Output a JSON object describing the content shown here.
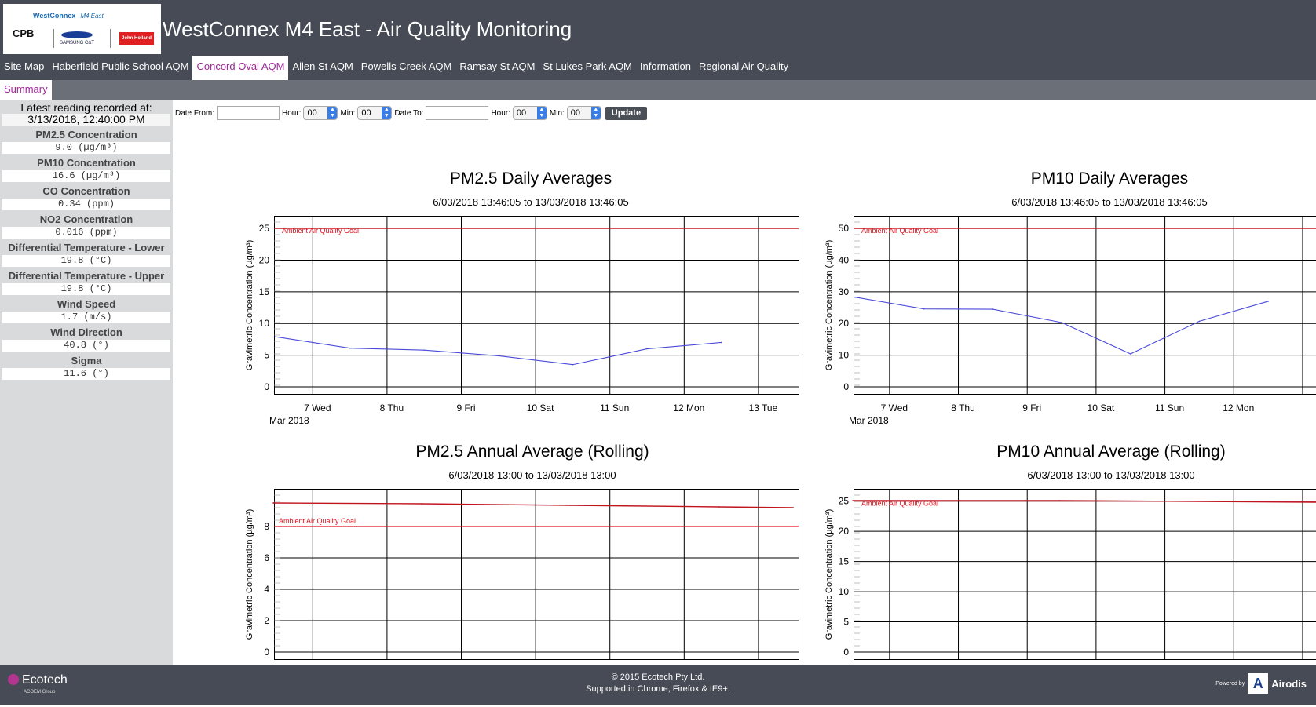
{
  "header": {
    "title": "WestConnex M4 East - Air Quality Monitoring",
    "logo": {
      "line1": "WestConnex",
      "line1b": "M4 East",
      "cpb": "CPB",
      "samsung": "SAMSUNG C&T",
      "jh": "John Holland"
    }
  },
  "nav": [
    {
      "label": "Site Map",
      "active": false
    },
    {
      "label": "Haberfield Public School AQM",
      "active": false
    },
    {
      "label": "Concord Oval AQM",
      "active": true
    },
    {
      "label": "Allen St AQM",
      "active": false
    },
    {
      "label": "Powells Creek AQM",
      "active": false
    },
    {
      "label": "Ramsay St AQM",
      "active": false
    },
    {
      "label": "St Lukes Park AQM",
      "active": false
    },
    {
      "label": "Information",
      "active": false
    },
    {
      "label": "Regional Air Quality",
      "active": false
    }
  ],
  "subtab": "Summary",
  "sidebar": {
    "latest_label": "Latest reading recorded at:",
    "latest_time": "3/13/2018, 12:40:00 PM",
    "readings": [
      {
        "label": "PM2.5 Concentration",
        "value": "9.0 (µg/m³)"
      },
      {
        "label": "PM10 Concentration",
        "value": "16.6 (µg/m³)"
      },
      {
        "label": "CO Concentration",
        "value": "0.34 (ppm)"
      },
      {
        "label": "NO2 Concentration",
        "value": "0.016 (ppm)"
      },
      {
        "label": "Differential Temperature - Lower",
        "value": "19.8 (°C)"
      },
      {
        "label": "Differential Temperature - Upper",
        "value": "19.8 (°C)"
      },
      {
        "label": "Wind Speed",
        "value": "1.7 (m/s)"
      },
      {
        "label": "Wind Direction",
        "value": "40.8 (°)"
      },
      {
        "label": "Sigma",
        "value": "11.6 (°)"
      }
    ]
  },
  "controls": {
    "date_from_label": "Date From:",
    "hour_label": "Hour:",
    "min_label": "Min:",
    "date_to_label": "Date To:",
    "hour_value": "00",
    "min_value": "00",
    "update_label": "Update"
  },
  "colors": {
    "line": "#4a4ad8",
    "goal": "#e0141e",
    "nav_active": "#9b2a96"
  },
  "chart_data": [
    {
      "type": "line",
      "title": "PM2.5 Daily Averages",
      "subtitle": "6/03/2018 13:46:05 to 13/03/2018 13:46:05",
      "ylabel": "Gravimetric Concentration (µg/m³)",
      "ylim": [
        0,
        26
      ],
      "yticks": [
        0,
        5,
        10,
        15,
        20,
        25
      ],
      "xticks": [
        "7 Wed",
        "8 Thu",
        "9 Fri",
        "10 Sat",
        "11 Sun",
        "12 Mon",
        "13 Tue"
      ],
      "xsub": "Mar 2018",
      "goal": {
        "label": "Ambient Air Quality Goal",
        "value": 25
      },
      "series": [
        {
          "values": [
            {
              "x": "2018-03-06 13:46",
              "y": 7.9
            },
            {
              "x": "2018-03-07 13:46",
              "y": 6.1
            },
            {
              "x": "2018-03-08 13:46",
              "y": 5.8
            },
            {
              "x": "2018-03-09 13:46",
              "y": 4.9
            },
            {
              "x": "2018-03-10 13:46",
              "y": 3.5
            },
            {
              "x": "2018-03-11 13:46",
              "y": 6.0
            },
            {
              "x": "2018-03-12 13:46",
              "y": 7.0
            }
          ]
        }
      ]
    },
    {
      "type": "line",
      "title": "PM10 Daily Averages",
      "subtitle": "6/03/2018 13:46:05 to 13/03/2018 13:46:05",
      "ylabel": "Gravimetric Concentration (µg/m³)",
      "ylim": [
        0,
        52
      ],
      "yticks": [
        0,
        10,
        20,
        30,
        40,
        50
      ],
      "xticks": [
        "7 Wed",
        "8 Thu",
        "9 Fri",
        "10 Sat",
        "11 Sun",
        "12 Mon"
      ],
      "xsub": "Mar 2018",
      "goal": {
        "label": "Ambient Air Quality Goal",
        "value": 50
      },
      "series": [
        {
          "values": [
            {
              "x": "2018-03-06 13:46",
              "y": 28.3
            },
            {
              "x": "2018-03-07 13:46",
              "y": 24.6
            },
            {
              "x": "2018-03-08 13:46",
              "y": 24.5
            },
            {
              "x": "2018-03-09 13:46",
              "y": 20.3
            },
            {
              "x": "2018-03-10 13:46",
              "y": 10.4
            },
            {
              "x": "2018-03-11 13:46",
              "y": 20.7
            },
            {
              "x": "2018-03-12 13:46",
              "y": 27.0
            }
          ]
        }
      ]
    },
    {
      "type": "line",
      "title": "PM2.5 Annual Average (Rolling)",
      "subtitle": "6/03/2018 13:00 to 13/03/2018 13:00",
      "ylabel": "Gravimetric Concentration (µg/m³)",
      "ylim": [
        0,
        10
      ],
      "yticks": [
        0,
        2,
        4,
        6,
        8
      ],
      "xticks": [],
      "goal": {
        "label": "Ambient Air Quality Goal",
        "value": 8
      },
      "series": [
        {
          "color": "#c0141e",
          "values": [
            {
              "x": "2018-03-06 13:00",
              "y": 9.5
            },
            {
              "x": "2018-03-08 13:00",
              "y": 9.45
            },
            {
              "x": "2018-03-10 13:00",
              "y": 9.35
            },
            {
              "x": "2018-03-12 13:00",
              "y": 9.25
            },
            {
              "x": "2018-03-13 13:00",
              "y": 9.2
            }
          ]
        }
      ]
    },
    {
      "type": "line",
      "title": "PM10 Annual Average (Rolling)",
      "subtitle": "6/03/2018 13:00 to 13/03/2018 13:00",
      "ylabel": "Gravimetric Concentration (µg/m³)",
      "ylim": [
        0,
        26
      ],
      "yticks": [
        0,
        5,
        10,
        15,
        20,
        25
      ],
      "xticks": [],
      "goal": {
        "label": "Ambient Air Quality Goal",
        "value": 25
      },
      "series": [
        {
          "color": "#c0141e",
          "values": [
            {
              "x": "2018-03-06 13:00",
              "y": 25.1
            },
            {
              "x": "2018-03-09 13:00",
              "y": 25.1
            },
            {
              "x": "2018-03-13 13:00",
              "y": 24.8
            }
          ]
        }
      ]
    }
  ],
  "footer": {
    "brand": "Ecotech",
    "brand_sub": "ACOEM Group",
    "copyright": "© 2015 Ecotech Pty Ltd.",
    "supported": "Supported in Chrome, Firefox & IE9+.",
    "powered": "Powered by",
    "airodis": "Airodis"
  }
}
